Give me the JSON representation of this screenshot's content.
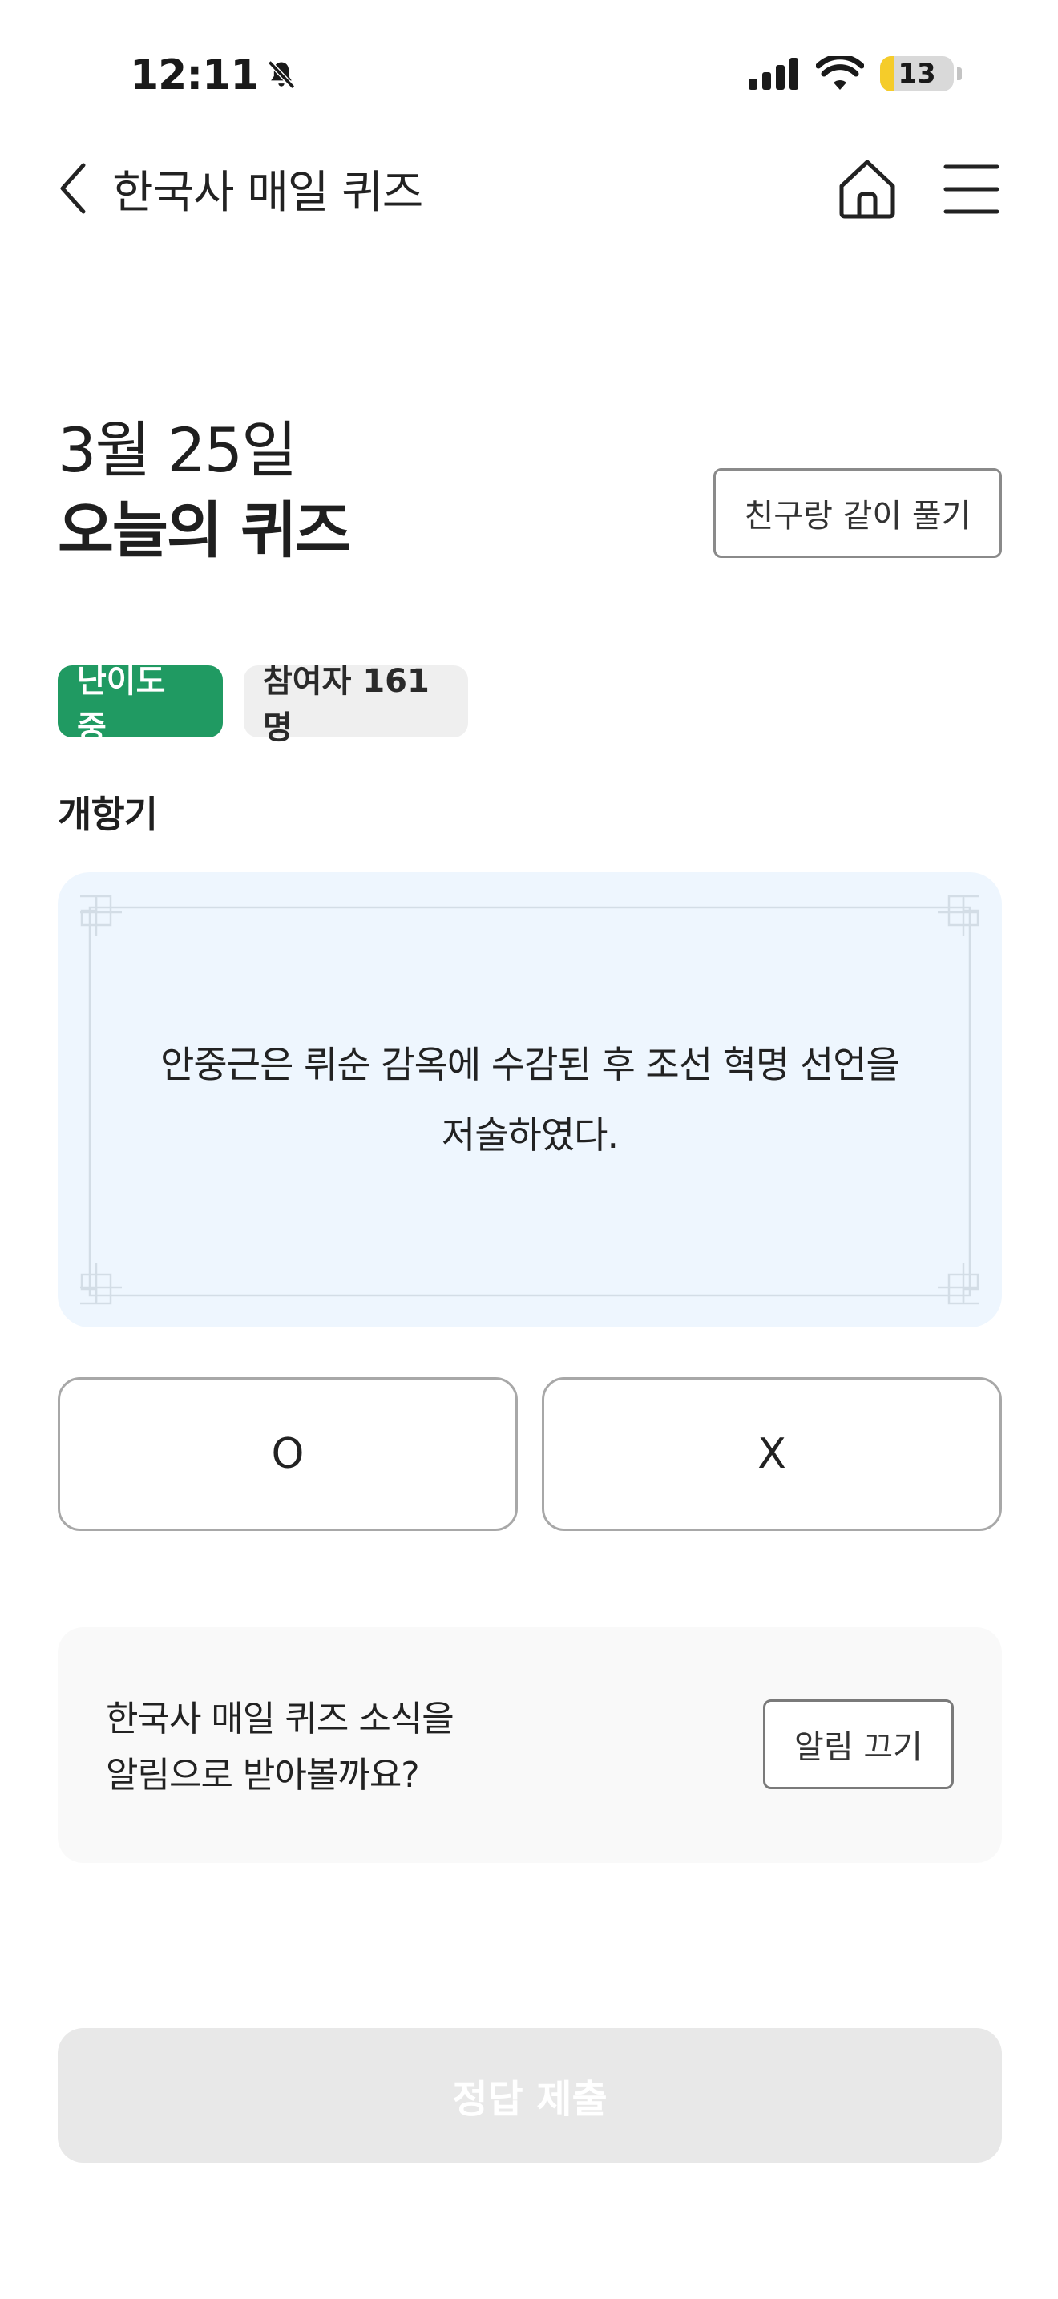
{
  "status_bar": {
    "time": "12:11",
    "battery_level": "13",
    "battery_fraction": 0.13,
    "icons": [
      "bell-slash-icon",
      "signal-icon",
      "wifi-icon",
      "battery-icon"
    ]
  },
  "nav": {
    "title": "한국사 매일 퀴즈",
    "icons": [
      "chevron-left-icon",
      "home-icon",
      "menu-icon"
    ]
  },
  "header": {
    "date": "3월 25일",
    "title": "오늘의 퀴즈",
    "friend_button": "친구랑 같이 풀기"
  },
  "badges": {
    "level": "난이도 중",
    "participants": "참여자 161명"
  },
  "colors": {
    "accent_green": "#209a62",
    "card_bg": "#eef6fe"
  },
  "category": "개항기",
  "question": {
    "line1": "안중근은 뤼순 감옥에 수감된 후 조선 혁명 선언을",
    "line2": "저술하였다."
  },
  "answers": {
    "o": "O",
    "x": "X"
  },
  "notify": {
    "line1": "한국사 매일 퀴즈 소식을",
    "line2": "알림으로 받아볼까요?",
    "button": "알림 끄기"
  },
  "submit_label": "정답 제출"
}
